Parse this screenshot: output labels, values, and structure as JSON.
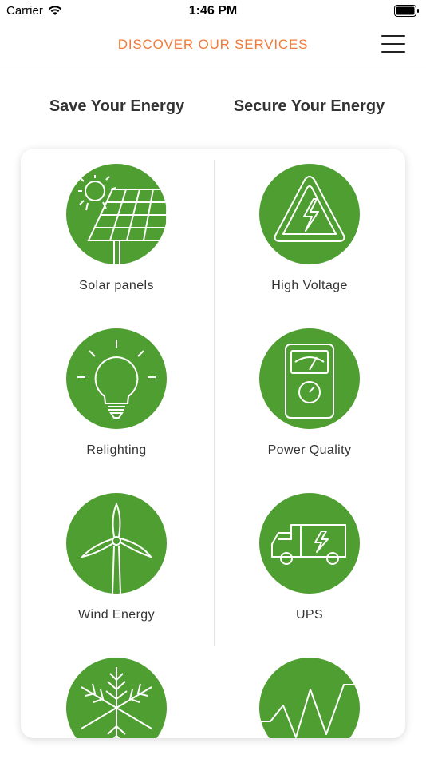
{
  "status_bar": {
    "carrier": "Carrier",
    "time": "1:46 PM"
  },
  "header": {
    "title": "DISCOVER OUR SERVICES",
    "menu_icon": "hamburger-menu-icon"
  },
  "sections": {
    "left_title": "Save Your Energy",
    "right_title": "Secure Your Energy"
  },
  "services": {
    "left": [
      {
        "label": "Solar panels",
        "icon": "solar-panel-icon"
      },
      {
        "label": "Relighting",
        "icon": "light-bulb-icon"
      },
      {
        "label": "Wind Energy",
        "icon": "wind-turbine-icon"
      },
      {
        "label": "",
        "icon": "snowflake-icon"
      }
    ],
    "right": [
      {
        "label": "High Voltage",
        "icon": "high-voltage-icon"
      },
      {
        "label": "Power Quality",
        "icon": "meter-icon"
      },
      {
        "label": "UPS",
        "icon": "van-icon"
      },
      {
        "label": "",
        "icon": "waveform-icon"
      }
    ]
  },
  "colors": {
    "accent": "#f07a3a",
    "icon_green": "#4f9e31"
  }
}
